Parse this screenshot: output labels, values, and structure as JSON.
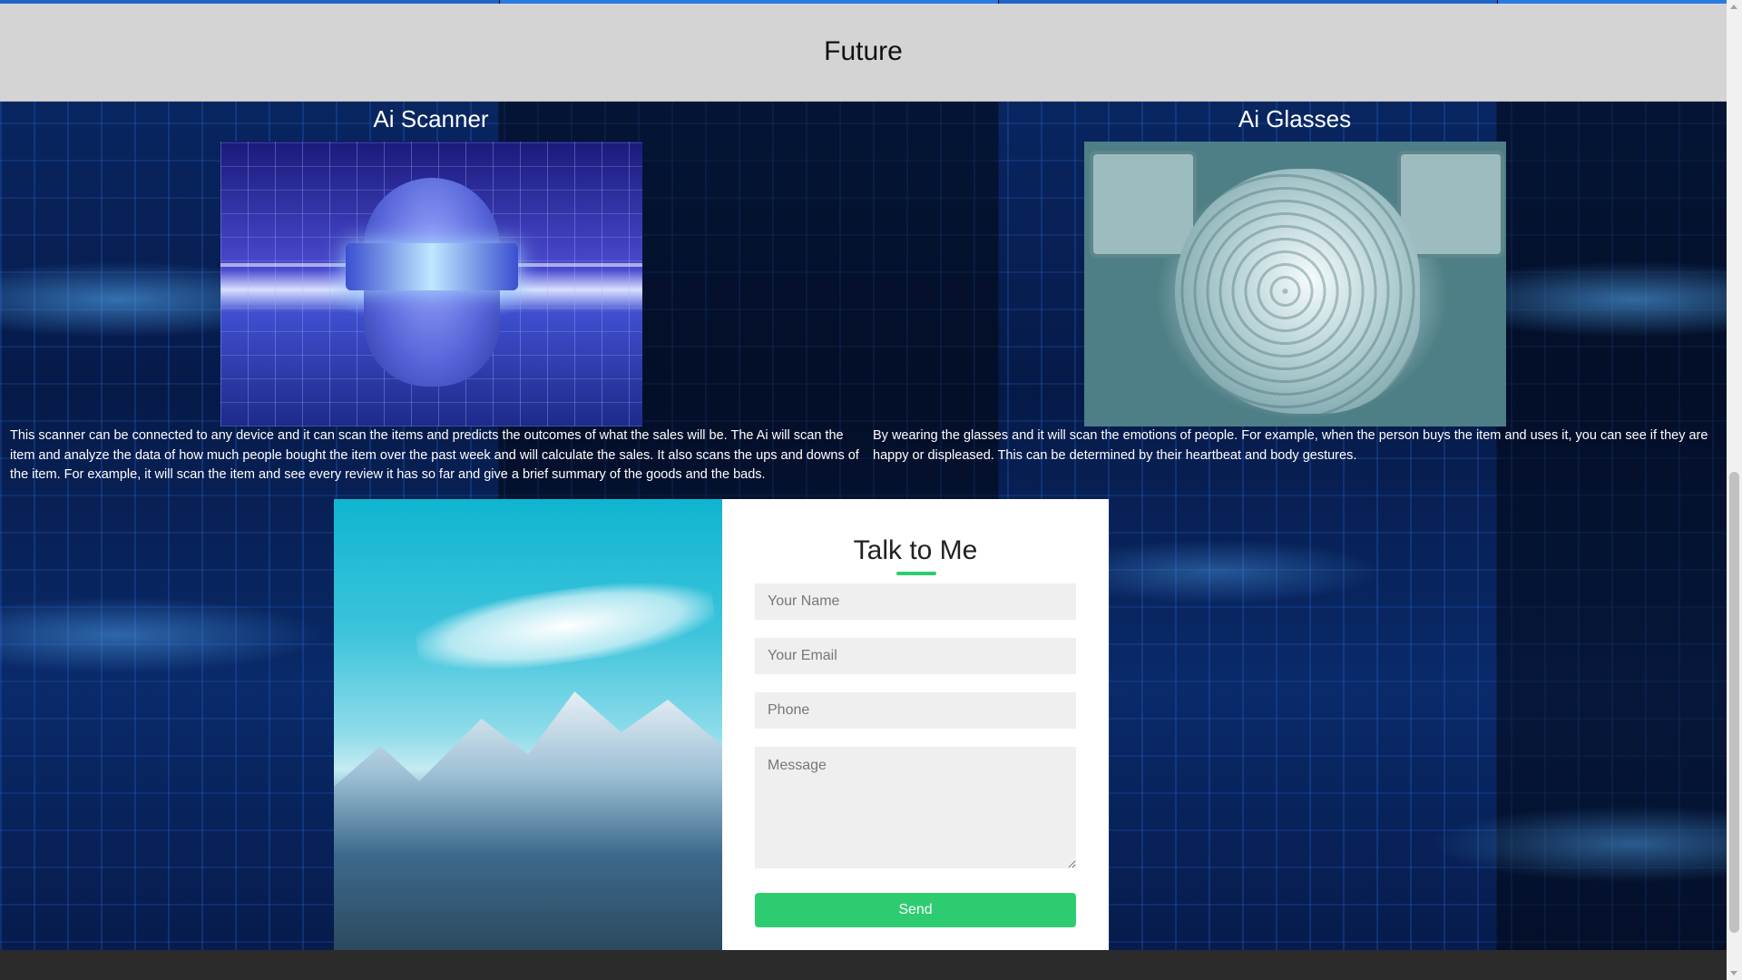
{
  "header": {
    "title": "Future"
  },
  "features": [
    {
      "title": "Ai Scanner",
      "image_icon": "ai-scanner-image",
      "description": "This scanner can be connected to any device and it can scan the items and predicts the outcomes of what the sales will be. The Ai will scan the item and analyze the data of how much people bought the item over the past week and will calculate the sales. It also scans the ups and downs of the item. For example, it will scan the item and see every review it has so far and give a brief summary of the goods and the bads."
    },
    {
      "title": "Ai Glasses",
      "image_icon": "ai-glasses-image",
      "description": "By wearing the glasses and it will scan the emotions of people. For example, when the person buys the item and uses it, you can see if they are happy or displeased. This can be determined by their heartbeat and body gestures."
    }
  ],
  "contact": {
    "title": "Talk to Me",
    "name_placeholder": "Your Name",
    "email_placeholder": "Your Email",
    "phone_placeholder": "Phone",
    "message_placeholder": "Message",
    "send_label": "Send",
    "accent_color": "#2ecc71"
  },
  "colors": {
    "header_bg": "#d4d4d4",
    "footer_bg": "#2b2b2b",
    "page_bg": "#061a48"
  }
}
